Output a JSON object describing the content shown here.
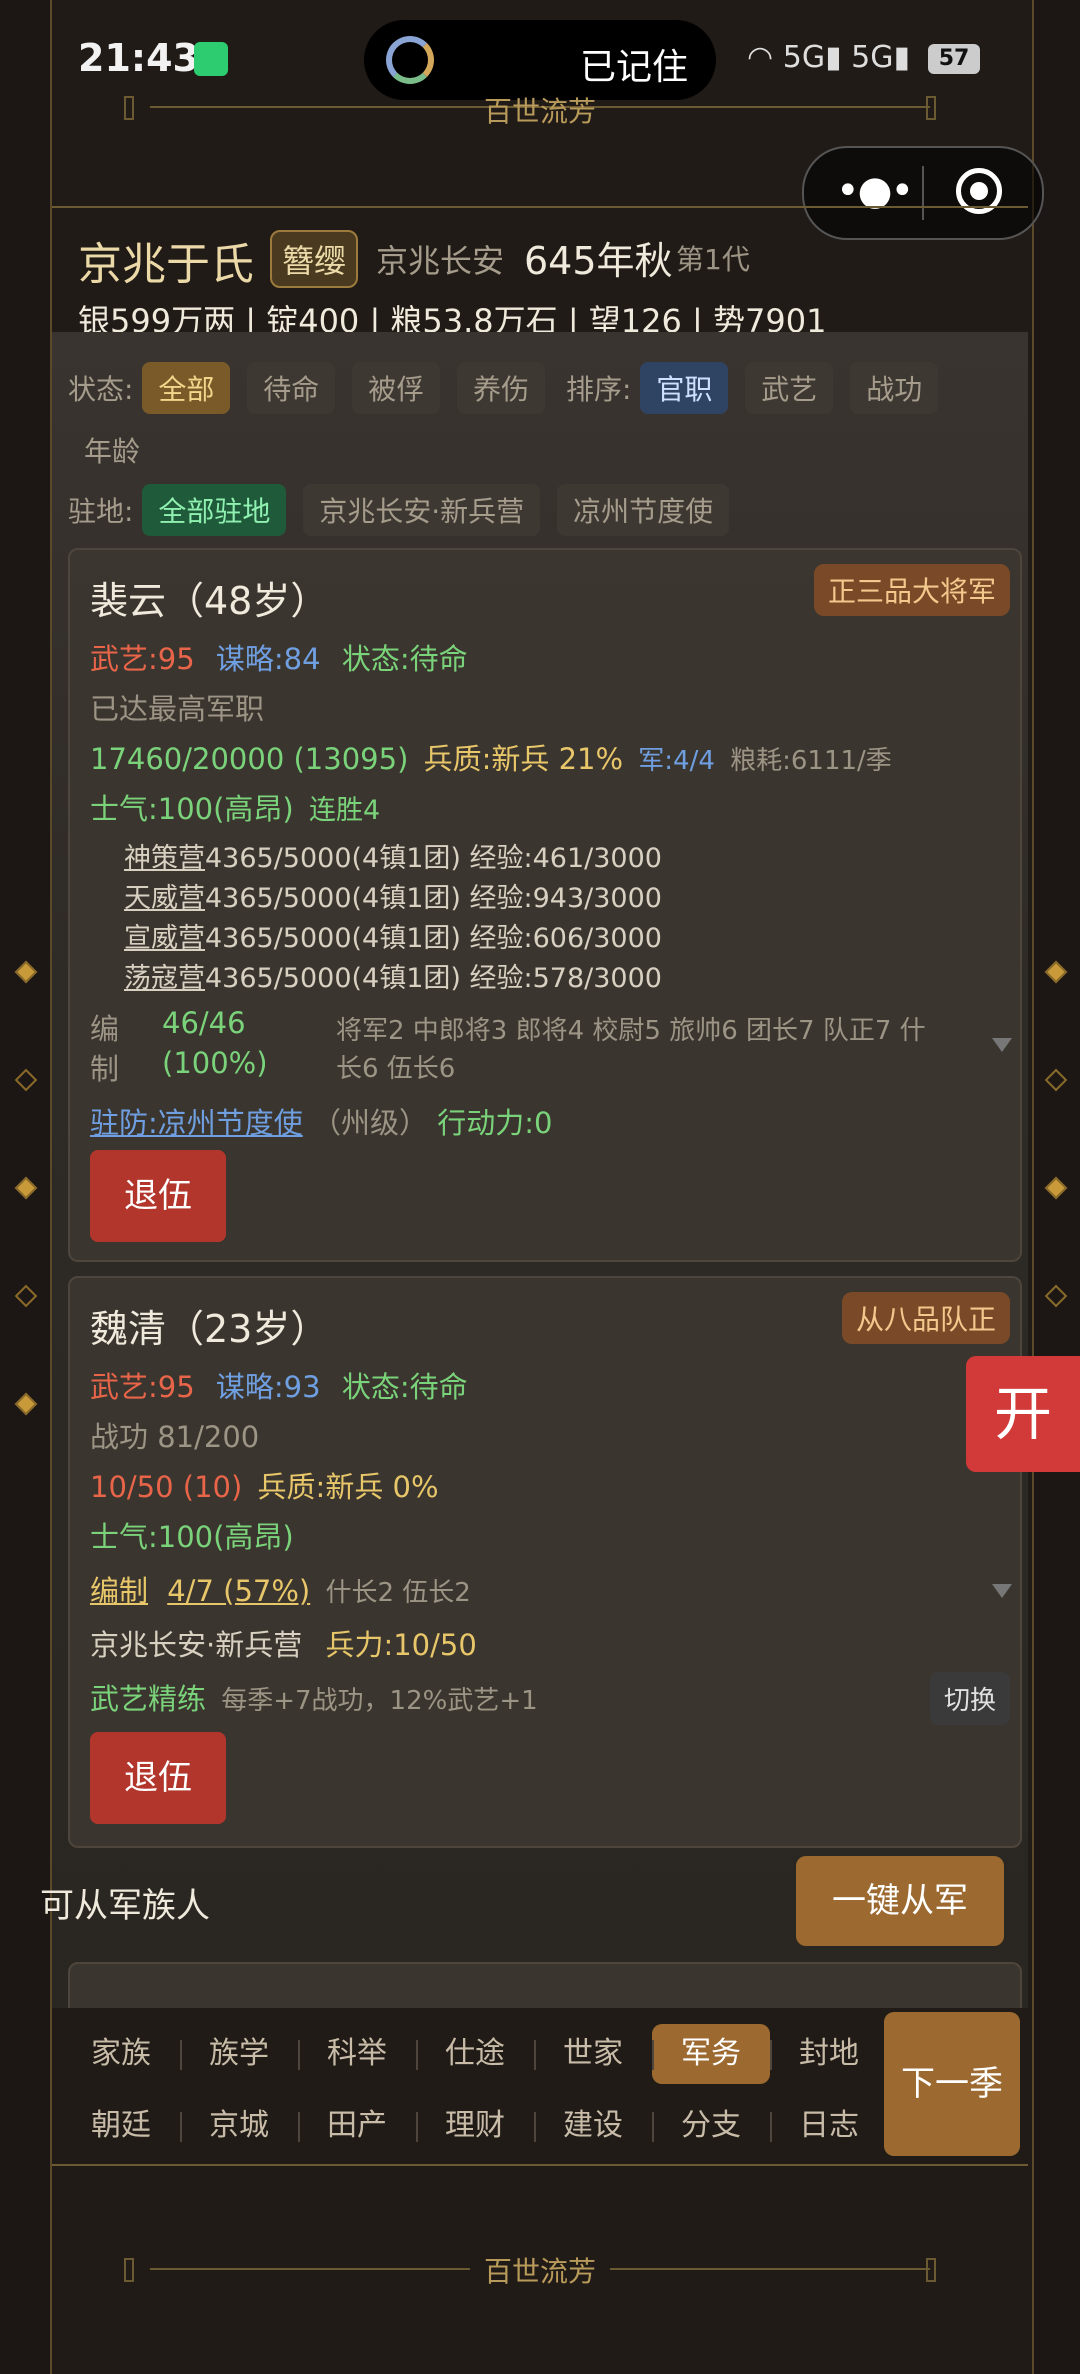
{
  "status_bar": {
    "time": "21:43",
    "notification": "已记住",
    "network": "5G",
    "battery": "57"
  },
  "footer_title": "百世流芳",
  "header": {
    "clan_name": "京兆于氏",
    "badge": "簪缨",
    "location": "京兆长安",
    "year": "645年秋",
    "generation": "第1代",
    "resources": "银599万两 | 锭400 | 粮53.8万石 | 望126 | 势7901"
  },
  "filters": {
    "status_label": "状态:",
    "status_options": [
      "全部",
      "待命",
      "被俘",
      "养伤"
    ],
    "sort_label": "排序:",
    "sort_options": [
      "官职",
      "武艺",
      "战功",
      "年龄"
    ],
    "garrison_label": "驻地:",
    "garrison_options": [
      "全部驻地",
      "京兆长安·新兵营",
      "凉州节度使"
    ]
  },
  "cards": [
    {
      "name": "裴云（48岁）",
      "rank": "正三品大将军",
      "martial": "武艺:95",
      "strategy": "谋略:84",
      "status": "状态:待命",
      "note": "已达最高军职",
      "troops": "17460/20000 (13095)",
      "quality": "兵质:新兵 21%",
      "army": "军:4/4",
      "food": "粮耗:6111/季",
      "morale": "士气:100(高昂)",
      "streak": "连胜4",
      "units": [
        {
          "name": "神策营",
          "rest": "4365/5000(4镇1团) 经验:461/3000"
        },
        {
          "name": "天威营",
          "rest": "4365/5000(4镇1团) 经验:943/3000"
        },
        {
          "name": "宣威营",
          "rest": "4365/5000(4镇1团) 经验:606/3000"
        },
        {
          "name": "荡寇营",
          "rest": "4365/5000(4镇1团) 经验:578/3000"
        }
      ],
      "staff_label_1": "编",
      "staff_label_2": "制",
      "staff_value": "46/46",
      "staff_pct": "(100%)",
      "staff_detail_1": "将军2 中郎将3 郎将4 校尉5 旅帅6 团长7 队正7 什",
      "staff_detail_2": "长6 伍长6",
      "garrison": "驻防:凉州节度使",
      "garrison_level": "（州级）",
      "action": "行动力:0",
      "retire": "退伍"
    },
    {
      "name": "魏清（23岁）",
      "rank": "从八品队正",
      "martial": "武艺:95",
      "strategy": "谋略:93",
      "status": "状态:待命",
      "merit": "战功 81/200",
      "troops": "10/50 (10)",
      "quality": "兵质:新兵 0%",
      "morale": "士气:100(高昂)",
      "staff_label": "编制",
      "staff_value": "4/7 (57%)",
      "staff_detail": "什长2 伍长2",
      "camp": "京兆长安·新兵营",
      "force": "兵力:10/50",
      "training": "武艺精练",
      "training_desc": "每季+7战功，12%武艺+1",
      "switch": "切换",
      "retire": "退伍"
    }
  ],
  "recruit": {
    "label": "可从军族人",
    "button": "一键从军"
  },
  "open_button": "开",
  "nav": {
    "row1": [
      "家族",
      "族学",
      "科举",
      "仕途",
      "世家",
      "军务",
      "封地"
    ],
    "row2": [
      "朝廷",
      "京城",
      "田产",
      "理财",
      "建设",
      "分支",
      "日志"
    ],
    "active": "军务",
    "next": "下一季"
  }
}
